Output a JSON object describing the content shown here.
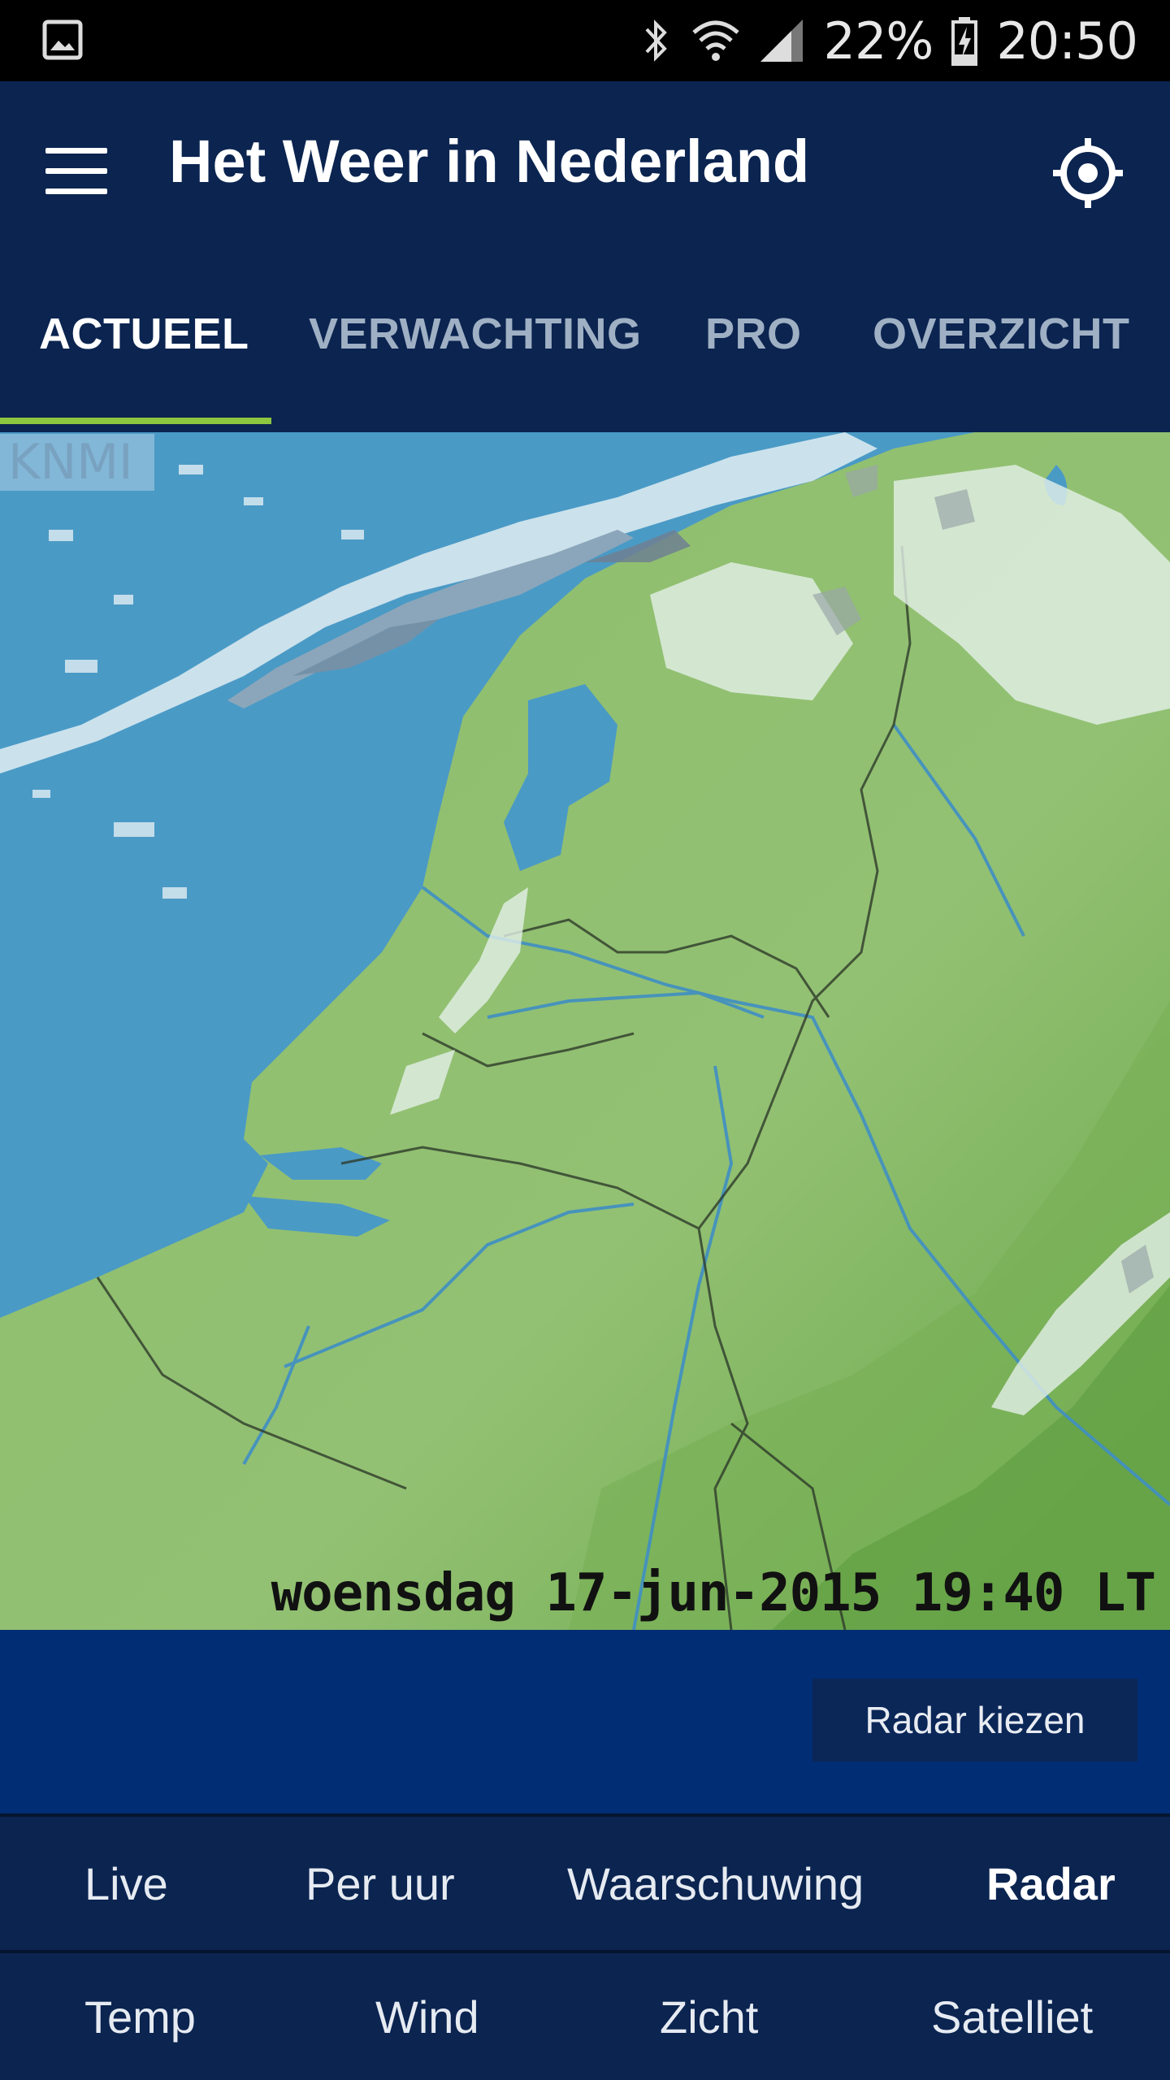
{
  "status_bar": {
    "battery": "22%",
    "time": "20:50",
    "icons": [
      "gallery-icon",
      "bluetooth-icon",
      "wifi-icon",
      "signal-icon",
      "battery-icon"
    ]
  },
  "app_bar": {
    "title": "Het Weer in Nederland",
    "menu_icon": "hamburger-menu-icon",
    "locate_icon": "gps-locate-icon"
  },
  "tabs": [
    {
      "label": "ACTUEEL",
      "active": true
    },
    {
      "label": "VERWACHTING",
      "active": false
    },
    {
      "label": "PRO",
      "active": false
    },
    {
      "label": "OVERZICHT",
      "active": false
    }
  ],
  "map": {
    "watermark": "KNMI",
    "timestamp": "woensdag 17-jun-2015 19:40 LT"
  },
  "actions": {
    "radar_button": "Radar kiezen"
  },
  "bottom_nav": {
    "row1": [
      {
        "label": "Live",
        "active": false
      },
      {
        "label": "Per uur",
        "active": false
      },
      {
        "label": "Waarschuwing",
        "active": false
      },
      {
        "label": "Radar",
        "active": true
      }
    ],
    "row2": [
      {
        "label": "Temp",
        "active": false
      },
      {
        "label": "Wind",
        "active": false
      },
      {
        "label": "Zicht",
        "active": false
      },
      {
        "label": "Satelliet",
        "active": false
      }
    ]
  },
  "colors": {
    "app_bar": "#0b2450",
    "tab_indicator": "#8dc63f",
    "action_area": "#002d73",
    "sea": "#4a9ac6",
    "land": "#8fbf6e"
  }
}
